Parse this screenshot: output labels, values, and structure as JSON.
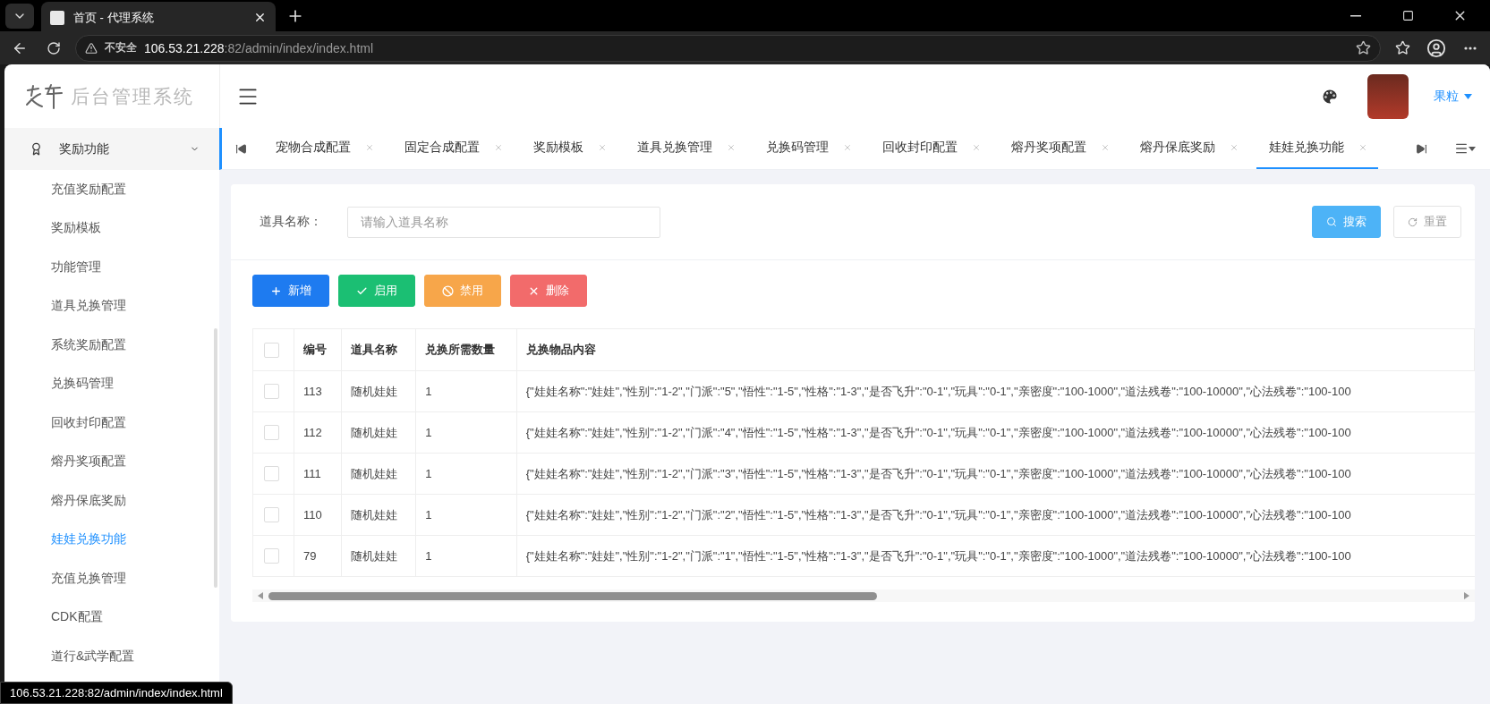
{
  "browser": {
    "tab_title": "首页 - 代理系统",
    "security_label": "不安全",
    "url_host": "106.53.21.228",
    "url_path": ":82/admin/index/index.html"
  },
  "logo": {
    "title": "后台管理系统"
  },
  "header": {
    "user_name": "果粒"
  },
  "sidebar": {
    "group": {
      "label": "奖励功能",
      "expanded": true,
      "items": [
        {
          "label": "充值奖励配置",
          "selected": false
        },
        {
          "label": "奖励模板",
          "selected": false
        },
        {
          "label": "功能管理",
          "selected": false
        },
        {
          "label": "道具兑换管理",
          "selected": false
        },
        {
          "label": "系统奖励配置",
          "selected": false
        },
        {
          "label": "兑换码管理",
          "selected": false
        },
        {
          "label": "回收封印配置",
          "selected": false
        },
        {
          "label": "熔丹奖项配置",
          "selected": false
        },
        {
          "label": "熔丹保底奖励",
          "selected": false
        },
        {
          "label": "娃娃兑换功能",
          "selected": true
        },
        {
          "label": "充值兑换管理",
          "selected": false
        },
        {
          "label": "CDK配置",
          "selected": false
        },
        {
          "label": "道行&武学配置",
          "selected": false
        }
      ]
    }
  },
  "tabs": [
    {
      "label": "宠物合成配置",
      "selected": false
    },
    {
      "label": "固定合成配置",
      "selected": false
    },
    {
      "label": "奖励模板",
      "selected": false
    },
    {
      "label": "道具兑换管理",
      "selected": false
    },
    {
      "label": "兑换码管理",
      "selected": false
    },
    {
      "label": "回收封印配置",
      "selected": false
    },
    {
      "label": "熔丹奖项配置",
      "selected": false
    },
    {
      "label": "熔丹保底奖励",
      "selected": false
    },
    {
      "label": "娃娃兑换功能",
      "selected": true
    }
  ],
  "search": {
    "label": "道具名称：",
    "placeholder": "请输入道具名称",
    "search_button": "搜索",
    "reset_button": "重置"
  },
  "toolbar": [
    {
      "kind": "add",
      "label": "新增"
    },
    {
      "kind": "enable",
      "label": "启用"
    },
    {
      "kind": "disable",
      "label": "禁用"
    },
    {
      "kind": "delete",
      "label": "删除"
    }
  ],
  "table": {
    "header_checked": false,
    "columns": [
      "编号",
      "道具名称",
      "兑换所需数量",
      "兑换物品内容"
    ],
    "rows": [
      {
        "checked": false,
        "cells": [
          "113",
          "随机娃娃",
          "1",
          "{\"娃娃名称\":\"娃娃\",\"性别\":\"1-2\",\"门派\":\"5\",\"悟性\":\"1-5\",\"性格\":\"1-3\",\"是否飞升\":\"0-1\",\"玩具\":\"0-1\",\"亲密度\":\"100-1000\",\"道法残卷\":\"100-10000\",\"心法残卷\":\"100-100"
        ]
      },
      {
        "checked": false,
        "cells": [
          "112",
          "随机娃娃",
          "1",
          "{\"娃娃名称\":\"娃娃\",\"性别\":\"1-2\",\"门派\":\"4\",\"悟性\":\"1-5\",\"性格\":\"1-3\",\"是否飞升\":\"0-1\",\"玩具\":\"0-1\",\"亲密度\":\"100-1000\",\"道法残卷\":\"100-10000\",\"心法残卷\":\"100-100"
        ]
      },
      {
        "checked": false,
        "cells": [
          "111",
          "随机娃娃",
          "1",
          "{\"娃娃名称\":\"娃娃\",\"性别\":\"1-2\",\"门派\":\"3\",\"悟性\":\"1-5\",\"性格\":\"1-3\",\"是否飞升\":\"0-1\",\"玩具\":\"0-1\",\"亲密度\":\"100-1000\",\"道法残卷\":\"100-10000\",\"心法残卷\":\"100-100"
        ]
      },
      {
        "checked": false,
        "cells": [
          "110",
          "随机娃娃",
          "1",
          "{\"娃娃名称\":\"娃娃\",\"性别\":\"1-2\",\"门派\":\"2\",\"悟性\":\"1-5\",\"性格\":\"1-3\",\"是否飞升\":\"0-1\",\"玩具\":\"0-1\",\"亲密度\":\"100-1000\",\"道法残卷\":\"100-10000\",\"心法残卷\":\"100-100"
        ]
      },
      {
        "checked": false,
        "cells": [
          "79",
          "随机娃娃",
          "1",
          "{\"娃娃名称\":\"娃娃\",\"性别\":\"1-2\",\"门派\":\"1\",\"悟性\":\"1-5\",\"性格\":\"1-3\",\"是否飞升\":\"0-1\",\"玩具\":\"0-1\",\"亲密度\":\"100-1000\",\"道法残卷\":\"100-10000\",\"心法残卷\":\"100-100"
        ]
      }
    ]
  },
  "status_bar": {
    "url": "106.53.21.228:82/admin/index/index.html"
  }
}
